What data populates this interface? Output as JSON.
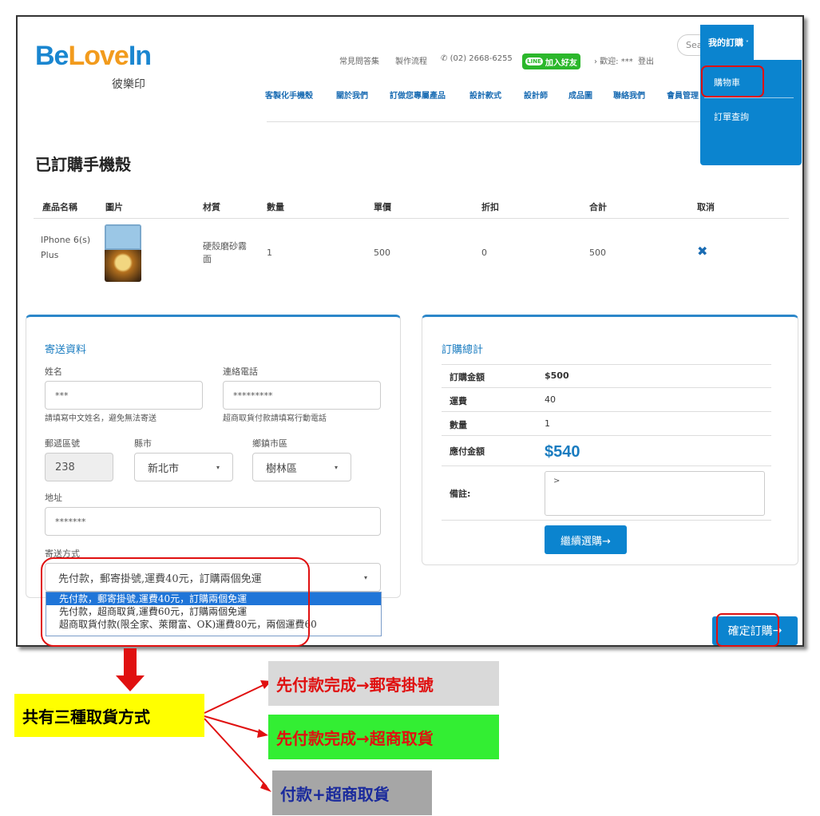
{
  "header": {
    "logo": {
      "be": "Be",
      "love": "Love",
      "in": "In",
      "sub": "彼樂印"
    },
    "top_links": [
      "常見問答集",
      "製作流程",
      "(02) 2668-6255"
    ],
    "line_button": "加入好友",
    "line_badge": "LINE",
    "welcome": "› 歡迎: ***",
    "logout": "登出",
    "search_placeholder": "Sea",
    "nav": [
      "客製化手機殼",
      "關於我們",
      "訂做您專屬產品",
      "設計款式",
      "設計師",
      "成品圖",
      "聯絡我們",
      "會員管理"
    ],
    "my_order": "我的訂購",
    "dropdown": [
      "購物車",
      "訂單查詢"
    ]
  },
  "page_title": "已訂購手機殼",
  "table": {
    "headers": [
      "產品名稱",
      "圖片",
      "材質",
      "數量",
      "單價",
      "折扣",
      "合計",
      "取消"
    ],
    "row": {
      "name_line1": "IPhone 6(s)",
      "name_line2": "Plus",
      "material_line1": "硬殼磨砂霧",
      "material_line2": "面",
      "qty": "1",
      "price": "500",
      "discount": "0",
      "subtotal": "500",
      "cancel": "✖"
    }
  },
  "shipping": {
    "title": "寄送資料",
    "name_label": "姓名",
    "name_value": "***",
    "name_hint": "請填寫中文姓名，避免無法寄送",
    "phone_label": "連絡電話",
    "phone_value": "*********",
    "phone_hint": "超商取貨付款請填寫行動電話",
    "zip_label": "郵遞區號",
    "zip_value": "238",
    "county_label": "縣市",
    "county_value": "新北市",
    "district_label": "鄉鎮市區",
    "district_value": "樹林區",
    "address_label": "地址",
    "address_value": "*******",
    "method_label": "寄送方式",
    "method_value": "先付款，郵寄掛號,運費40元，訂購兩個免運",
    "method_options": [
      "先付款，郵寄掛號,運費40元，訂購兩個免運",
      "先付款，超商取貨,運費60元，訂購兩個免運",
      "超商取貨付款(限全家、萊爾富、OK)運費80元，兩個運費60"
    ]
  },
  "summary": {
    "title": "訂購總計",
    "rows": [
      {
        "label": "訂購金額",
        "value": "$500"
      },
      {
        "label": "運費",
        "value": "40"
      },
      {
        "label": "數量",
        "value": "1"
      }
    ],
    "total_label": "應付金額",
    "total_value": "$540",
    "note_label": "備註:",
    "note_value": ">",
    "continue_button": "繼續選購→"
  },
  "confirm_button": "確定訂購",
  "confirm_arrow": "→",
  "annotation": {
    "main": "共有三種取貨方式",
    "option1": "先付款完成→郵寄掛號",
    "option2": "先付款完成→超商取貨",
    "option3": "付款+超商取貨",
    "colors": {
      "main_bg": "#ffff00",
      "opt1_bg": "#d9d9d9",
      "opt2_bg": "#33ee33",
      "opt3_bg": "#a6a6a6",
      "red": "#e01010"
    }
  }
}
